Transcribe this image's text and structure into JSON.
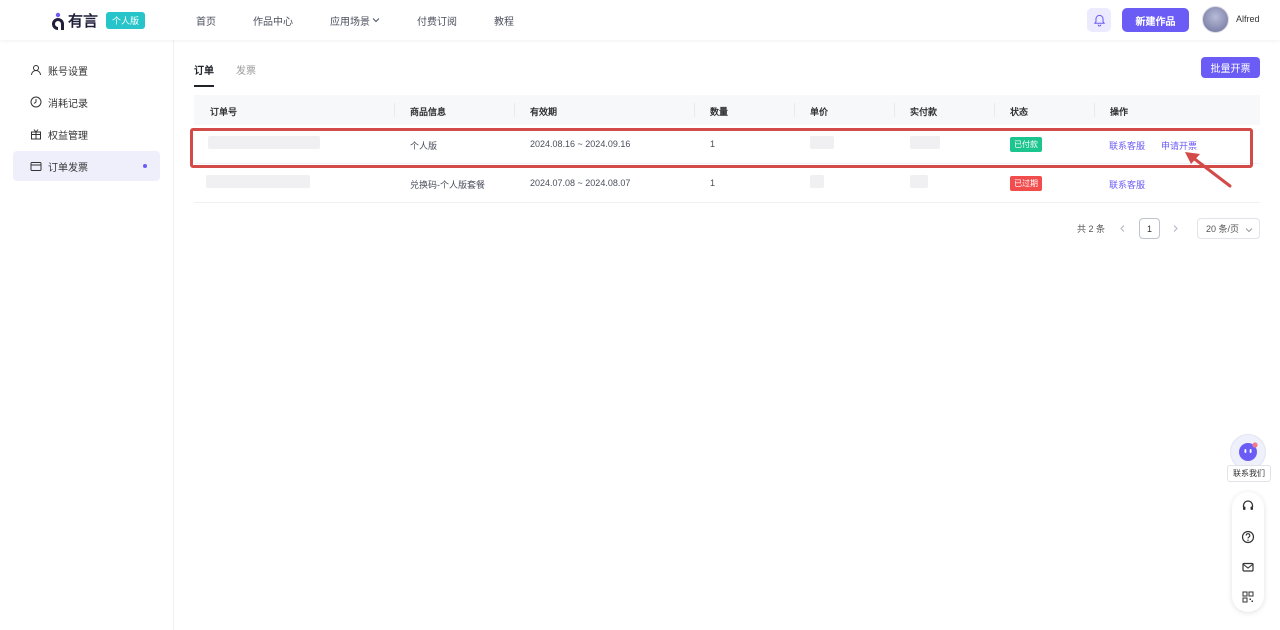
{
  "header": {
    "logo_text": "有言",
    "edition": "个人版",
    "nav": [
      "首页",
      "作品中心",
      "应用场景",
      "付费订阅",
      "教程"
    ],
    "new_button": "新建作品",
    "username": "Alfred",
    "icons": [
      "bell-icon",
      "avatar"
    ]
  },
  "sidebar": {
    "items": [
      {
        "label": "账号设置",
        "icon": "user-icon"
      },
      {
        "label": "消耗记录",
        "icon": "clock-icon"
      },
      {
        "label": "权益管理",
        "icon": "gift-icon"
      },
      {
        "label": "订单发票",
        "icon": "wallet-icon"
      }
    ],
    "active_index": 3
  },
  "main": {
    "tabs": [
      "订单",
      "发票"
    ],
    "active_tab": "订单",
    "batch_button": "批量开票",
    "table": {
      "columns": [
        "订单号",
        "商品信息",
        "有效期",
        "数量",
        "单价",
        "实付款",
        "状态",
        "操作"
      ],
      "rows": [
        {
          "product": "个人版",
          "validity": "2024.08.16 ~ 2024.09.16",
          "quantity": "1",
          "status": "已付款",
          "actions": [
            "联系客服",
            "申请开票"
          ]
        },
        {
          "product": "兑换码-个人版套餐",
          "validity": "2024.07.08 ~ 2024.08.07",
          "quantity": "1",
          "status": "已过期",
          "actions": [
            "联系客服"
          ]
        }
      ]
    },
    "pagination": {
      "total": "共 2 条",
      "current_page": "1",
      "page_size": "20 条/页"
    }
  },
  "floating": {
    "contact_label": "联系我们",
    "tool_icons": [
      "headset-icon",
      "help-icon",
      "mail-icon",
      "qrcode-icon"
    ]
  },
  "colors": {
    "accent": "#6b5cf6",
    "paid": "#1cc48e",
    "expired": "#f24d4d",
    "highlight": "#d24b48",
    "badge": "#27c4c9"
  }
}
